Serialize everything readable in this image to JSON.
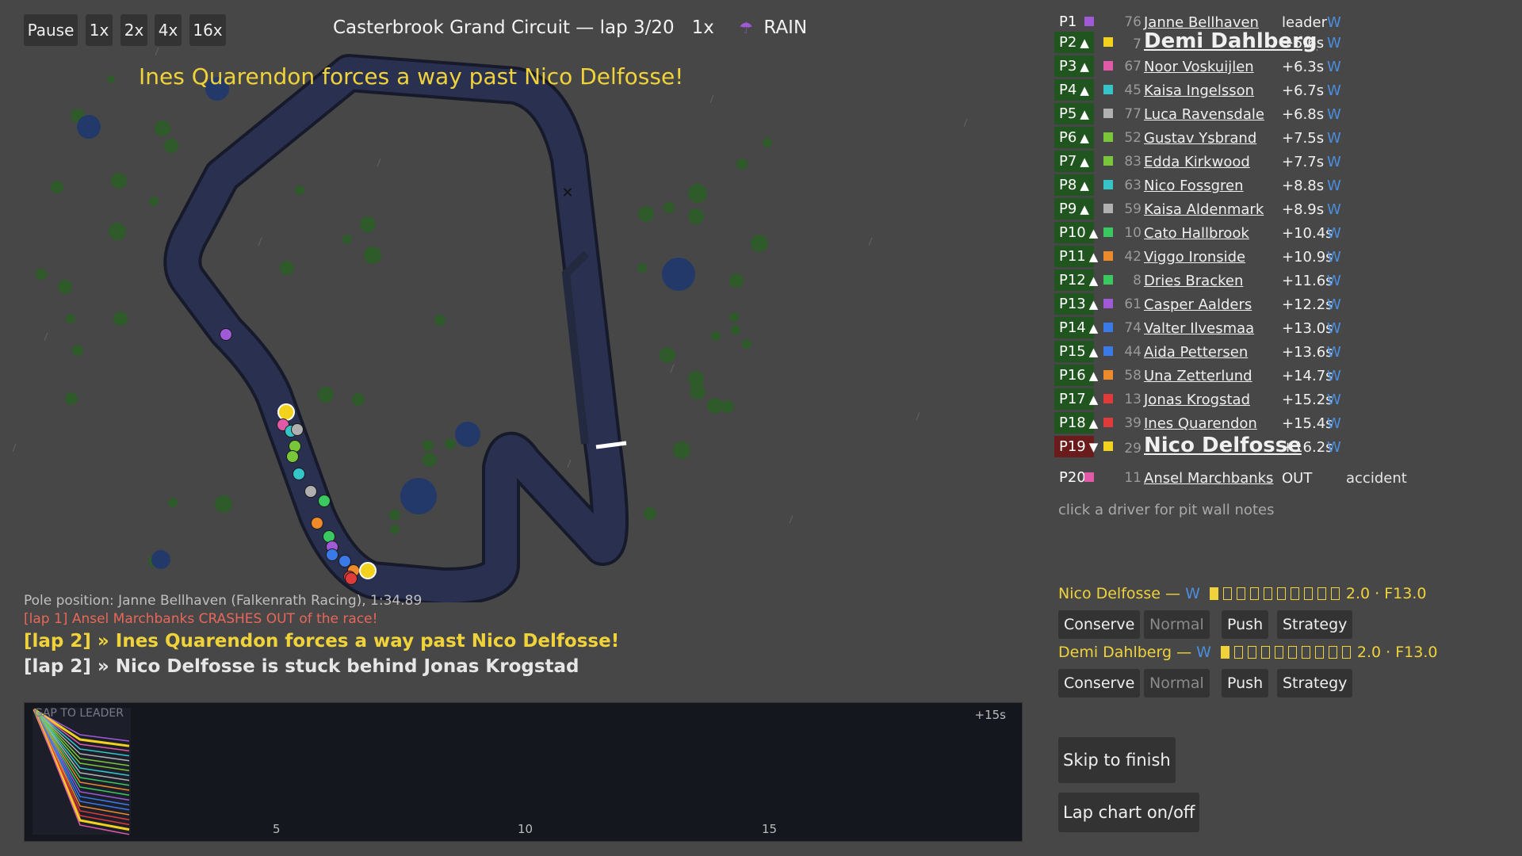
{
  "controls": {
    "pause_label": "Pause",
    "speeds": [
      "1x",
      "2x",
      "4x",
      "16x"
    ]
  },
  "race": {
    "title": "Casterbrook Grand Circuit — lap 3/20   1x",
    "weather": "RAIN",
    "weather_icon": "umbrella-icon",
    "headline": "Ines Quarendon forces a way past Nico Delfosse!"
  },
  "log": {
    "pole": "Pole position: Janne Bellhaven (Falkenrath Racing), 1:34.89",
    "crash": "[lap 1] Ansel Marchbanks CRASHES OUT of the race!",
    "events": [
      "[lap 2] » Ines Quarendon forces a way past Nico Delfosse!",
      "[lap 2] » Nico Delfosse is stuck behind Jonas Krogstad"
    ]
  },
  "lap_chart": {
    "title": "GAP TO LEADER",
    "y_label": "+15s",
    "x_ticks": [
      "5",
      "10",
      "15"
    ]
  },
  "standings": [
    {
      "pos": "P1",
      "arrow": "",
      "color": "#a05ad8",
      "num": "76",
      "name": "Janne Bellhaven",
      "gap": "leader",
      "tyre": "W"
    },
    {
      "pos": "P2",
      "arrow": "▲",
      "color": "#f2d21c",
      "num": "7",
      "name": "Demi Dahlberg",
      "gap": "+5.6s",
      "tyre": "W",
      "highlight": true
    },
    {
      "pos": "P3",
      "arrow": "▲",
      "color": "#e05aa8",
      "num": "67",
      "name": "Noor Voskuijlen",
      "gap": "+6.3s",
      "tyre": "W"
    },
    {
      "pos": "P4",
      "arrow": "▲",
      "color": "#35c4c8",
      "num": "45",
      "name": "Kaisa Ingelsson",
      "gap": "+6.7s",
      "tyre": "W"
    },
    {
      "pos": "P5",
      "arrow": "▲",
      "color": "#b0b0b0",
      "num": "77",
      "name": "Luca Ravensdale",
      "gap": "+6.8s",
      "tyre": "W"
    },
    {
      "pos": "P6",
      "arrow": "▲",
      "color": "#7ac63a",
      "num": "52",
      "name": "Gustav Ysbrand",
      "gap": "+7.5s",
      "tyre": "W"
    },
    {
      "pos": "P7",
      "arrow": "▲",
      "color": "#7ac63a",
      "num": "83",
      "name": "Edda Kirkwood",
      "gap": "+7.7s",
      "tyre": "W"
    },
    {
      "pos": "P8",
      "arrow": "▲",
      "color": "#35c4c8",
      "num": "63",
      "name": "Nico Fossgren",
      "gap": "+8.8s",
      "tyre": "W"
    },
    {
      "pos": "P9",
      "arrow": "▲",
      "color": "#b0b0b0",
      "num": "59",
      "name": "Kaisa Aldenmark",
      "gap": "+8.9s",
      "tyre": "W"
    },
    {
      "pos": "P10",
      "arrow": "▲",
      "color": "#3ac860",
      "num": "10",
      "name": "Cato Hallbrook",
      "gap": "+10.4s",
      "tyre": "W"
    },
    {
      "pos": "P11",
      "arrow": "▲",
      "color": "#ee8a2a",
      "num": "42",
      "name": "Viggo Ironside",
      "gap": "+10.9s",
      "tyre": "W"
    },
    {
      "pos": "P12",
      "arrow": "▲",
      "color": "#3ac860",
      "num": "8",
      "name": "Dries Bracken",
      "gap": "+11.6s",
      "tyre": "W"
    },
    {
      "pos": "P13",
      "arrow": "▲",
      "color": "#a05ad8",
      "num": "61",
      "name": "Casper Aalders",
      "gap": "+12.2s",
      "tyre": "W"
    },
    {
      "pos": "P14",
      "arrow": "▲",
      "color": "#3a7ae8",
      "num": "74",
      "name": "Valter Ilvesmaa",
      "gap": "+13.0s",
      "tyre": "W"
    },
    {
      "pos": "P15",
      "arrow": "▲",
      "color": "#3a7ae8",
      "num": "44",
      "name": "Aida Pettersen",
      "gap": "+13.6s",
      "tyre": "W"
    },
    {
      "pos": "P16",
      "arrow": "▲",
      "color": "#ee8a2a",
      "num": "58",
      "name": "Una Zetterlund",
      "gap": "+14.7s",
      "tyre": "W"
    },
    {
      "pos": "P17",
      "arrow": "▲",
      "color": "#e03a3a",
      "num": "13",
      "name": "Jonas Krogstad",
      "gap": "+15.2s",
      "tyre": "W"
    },
    {
      "pos": "P18",
      "arrow": "▲",
      "color": "#e03a3a",
      "num": "39",
      "name": "Ines Quarendon",
      "gap": "+15.4s",
      "tyre": "W"
    },
    {
      "pos": "P19",
      "arrow": "▼",
      "color": "#f2d21c",
      "num": "29",
      "name": "Nico Delfosse",
      "gap": "+16.2s",
      "tyre": "W",
      "highlight": true
    },
    {
      "pos": "P20",
      "arrow": "",
      "color": "#e05aa8",
      "num": "11",
      "name": "Ansel Marchbanks",
      "gap": "OUT",
      "tyre": "accident"
    }
  ],
  "hint": "click a driver for pit wall notes",
  "pit_wall": [
    {
      "driver": "Nico Delfosse — ",
      "tyre": "W",
      "stats": "2.0 · F13.0",
      "wear_boxes": 10,
      "filled": 1,
      "modes": [
        "Conserve",
        "Normal",
        "Push",
        "Strategy"
      ],
      "active_mode": "Normal"
    },
    {
      "driver": "Demi Dahlberg — ",
      "tyre": "W",
      "stats": "2.0 · F13.0",
      "wear_boxes": 10,
      "filled": 1,
      "modes": [
        "Conserve",
        "Normal",
        "Push",
        "Strategy"
      ],
      "active_mode": "Normal"
    }
  ],
  "actions": {
    "skip": "Skip to finish",
    "lap_chart": "Lap chart on/off"
  },
  "colors": {
    "accent": "#f0d33a",
    "crash": "#e8675a",
    "tyre_wet": "#4a8ee0",
    "track": "#2a3150",
    "background": "#474747"
  }
}
